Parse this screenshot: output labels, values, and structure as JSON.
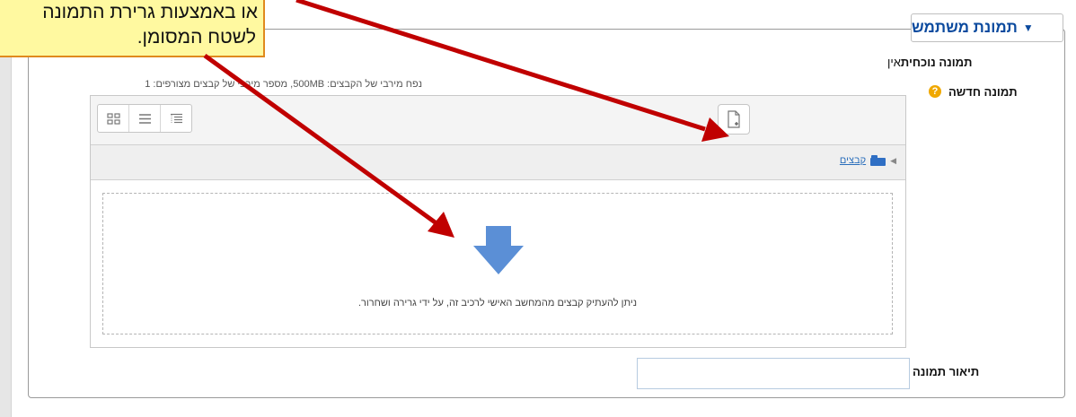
{
  "fieldset": {
    "legend_label": "תמונת משתמש",
    "legend_toggle": "▼"
  },
  "current_picture": {
    "label": "תמונה נוכחית",
    "value": "אין"
  },
  "new_picture": {
    "label": "תמונה חדשה",
    "help_icon": "?",
    "max_info": "נפח מירבי של הקבצים: 500MB, מספר מירבי של קבצים מצורפים: 1"
  },
  "filemanager": {
    "view_icons": [
      "icons-view-icon",
      "list-view-icon",
      "tree-view-icon"
    ],
    "add_file_icon": "add-file-icon",
    "path_label": "קבצים",
    "path_arrow": "◀",
    "dropzone_text": "ניתן להעתיק קבצים מהמחשב האישי לרכיב זה, על ידי גרירה ושחרור.",
    "drop_arrow_color": "#5b8fd6"
  },
  "description": {
    "label": "תיאור תמונה",
    "value": ""
  },
  "callout": {
    "line1": "או באמצעות גרירת התמונה",
    "line2": "לשטח המסומן."
  },
  "colors": {
    "accent": "#0b4a9e",
    "arrow": "#c00000",
    "callout_bg": "#fff9a0",
    "callout_border": "#e08a1e"
  }
}
